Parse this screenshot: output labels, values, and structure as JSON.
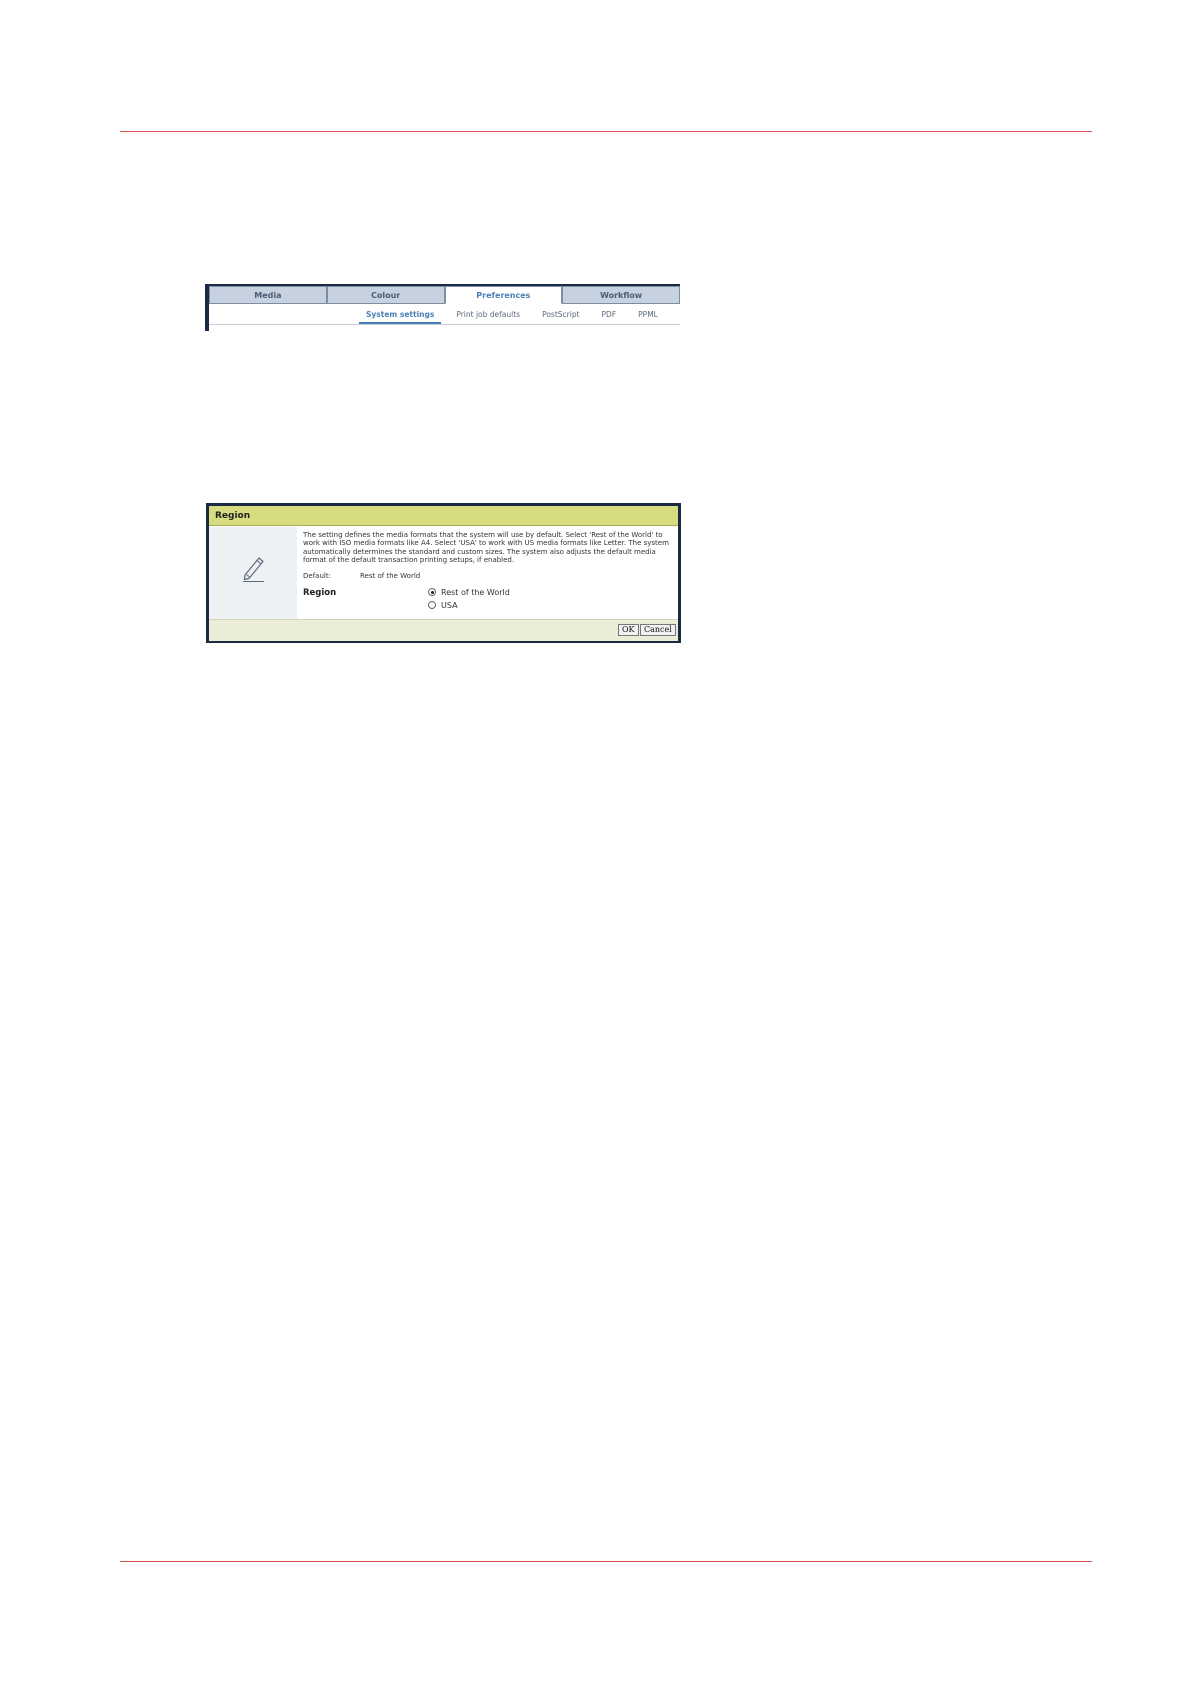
{
  "tabs": {
    "main": [
      {
        "label": "Media"
      },
      {
        "label": "Colour"
      },
      {
        "label": "Preferences",
        "active": true
      },
      {
        "label": "Workflow"
      }
    ],
    "sub": [
      {
        "label": "System settings",
        "active": true
      },
      {
        "label": "Print job defaults"
      },
      {
        "label": "PostScript"
      },
      {
        "label": "PDF"
      },
      {
        "label": "PPML"
      }
    ]
  },
  "dialog": {
    "title": "Region",
    "icon": "pencil-icon",
    "description": "The setting defines the media formats that the system will use by default. Select 'Rest of the World' to work with ISO media formats like A4. Select 'USA' to work with US media formats like Letter. The system automatically determines the standard and custom sizes. The system also adjusts the default media format of the default transaction printing setups, if enabled.",
    "default_label": "Default:",
    "default_value": "Rest of the World",
    "setting_name": "Region",
    "options": [
      {
        "label": "Rest of the World",
        "selected": true
      },
      {
        "label": "USA",
        "selected": false
      }
    ],
    "ok_label": "OK",
    "cancel_label": "Cancel"
  },
  "colors": {
    "rule": "#d9534f",
    "dialog_title_bg": "#d8dc80",
    "frame": "#1b2a45",
    "active_tab_text": "#4a7fb6"
  }
}
